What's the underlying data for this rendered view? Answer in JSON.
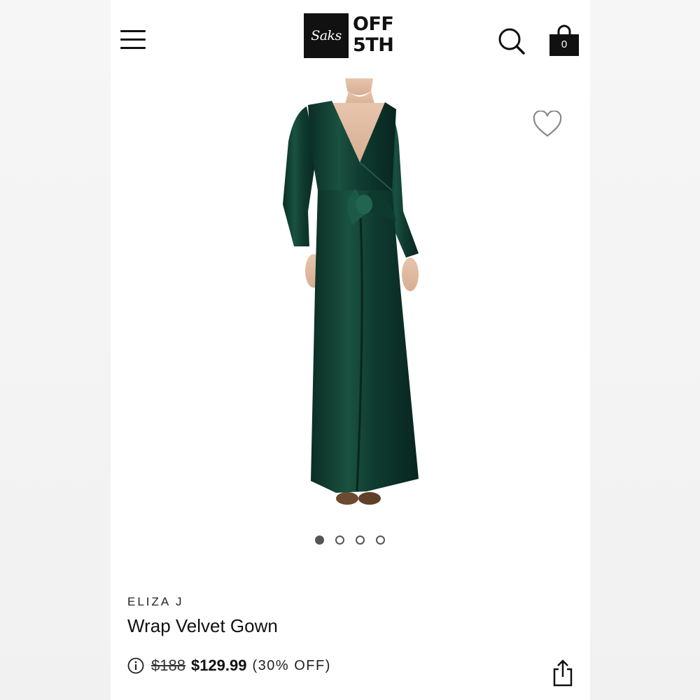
{
  "header": {
    "logo_script": "Saks",
    "logo_line1": "OFF",
    "logo_line2": "5TH",
    "bag_count": "0",
    "icons": {
      "menu": "hamburger-menu-icon",
      "search": "search-icon",
      "bag": "shopping-bag-icon"
    }
  },
  "product": {
    "brand": "ELIZA J",
    "name": "Wrap Velvet Gown",
    "original_price": "$188",
    "sale_price": "$129.99",
    "discount": "(30% OFF)",
    "dress_color": "#0f3b2f",
    "image_count": 4,
    "active_image": 1,
    "icons": {
      "wishlist": "heart-outline-icon",
      "info": "info-circle-icon",
      "share": "share-icon"
    }
  }
}
